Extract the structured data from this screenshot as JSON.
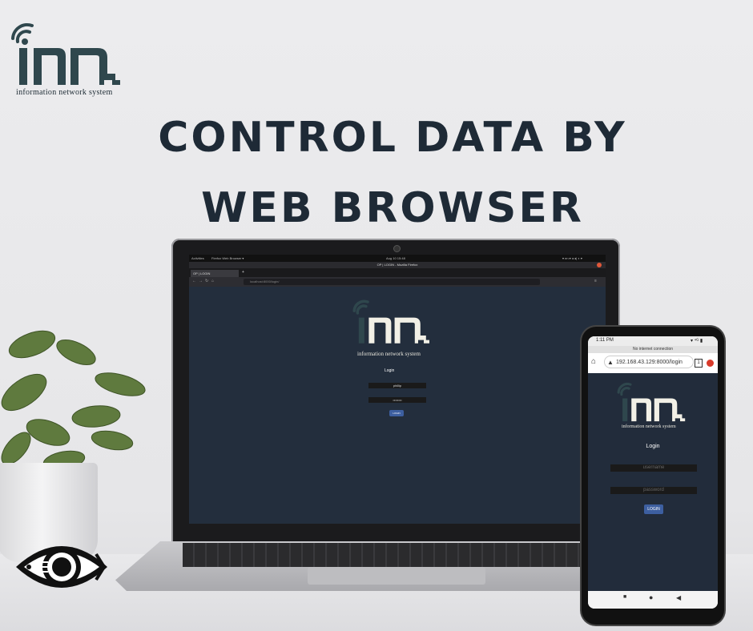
{
  "brand": {
    "logo_text": "inn",
    "tagline": "information  network system"
  },
  "headline": "CONTROL DATA BY WEB BROWSER",
  "laptop": {
    "os_bar": {
      "activities": "Activities",
      "app": "Firefox Web Browser ▾",
      "clock": "Aug 10  15:48",
      "right": "▾ en ▾  ◂ ◂) ◐ ▾"
    },
    "window_title": "OP | LOGIN - Mozilla Firefox",
    "tab_label": "OP | LOGIN",
    "new_tab": "+",
    "url": "localhost:8000/login/",
    "page": {
      "tagline": "information  network system",
      "heading": "Login",
      "username_value": "phillip",
      "password_value": "••••••••",
      "login_button": "LOGIN"
    }
  },
  "phone": {
    "status": {
      "time": "1:11 PM",
      "right": "▾ ⁴ᴳ ▮"
    },
    "banner": "No internet connection",
    "url": "192.168.43.129:8000/login",
    "tab_count": "1",
    "page": {
      "tagline": "information  network system",
      "heading": "Login",
      "username_placeholder": "username",
      "password_placeholder": "password",
      "login_button": "LOGIN"
    },
    "nav": {
      "square": "■",
      "circle": "●",
      "back": "◀"
    }
  },
  "colors": {
    "background": "#e8e8ea",
    "headline": "#1e2a36",
    "logo_dark": "#2f474d",
    "logo_light": "#f2f0e6",
    "page_bg": "#232e3d",
    "button": "#3d5fa0"
  }
}
